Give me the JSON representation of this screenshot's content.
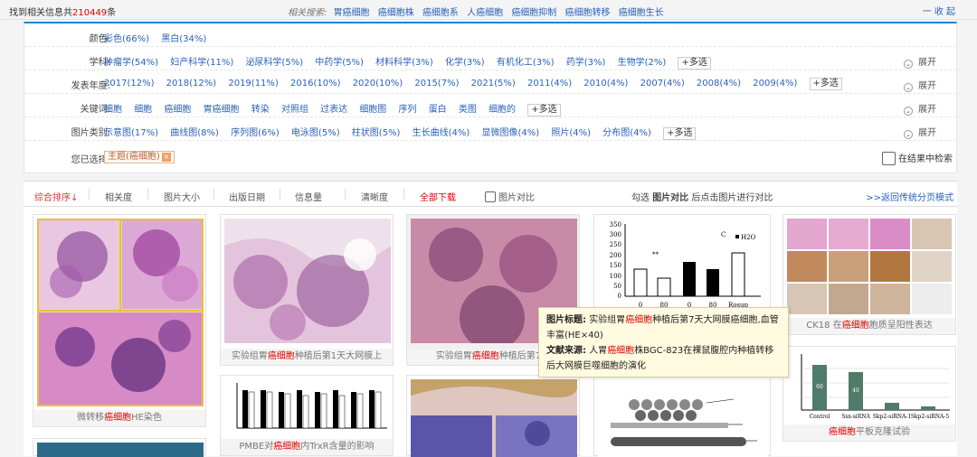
{
  "topbar": {
    "found_prefix": "找到相关信息共",
    "found_count": "210449",
    "found_suffix": "条",
    "related_label": "相关搜索:",
    "related_terms": [
      "胃癌细胞",
      "癌细胞株",
      "癌细胞系",
      "人癌细胞",
      "癌细胞抑制",
      "癌细胞转移",
      "癌细胞生长"
    ],
    "collapse_label": "一 收 起"
  },
  "filters": {
    "color": {
      "label": "颜色:",
      "options": [
        "彩色(66%)",
        "黑白(34%)"
      ]
    },
    "subject": {
      "label": "学科:",
      "options": [
        "肿瘤学(54%)",
        "妇产科学(11%)",
        "泌尿科学(5%)",
        "中药学(5%)",
        "材料科学(3%)",
        "化学(3%)",
        "有机化工(3%)",
        "药学(3%)",
        "生物学(2%)"
      ],
      "more": "+多选",
      "expand": "展开"
    },
    "year": {
      "label": "发表年度:",
      "options": [
        "2017(12%)",
        "2018(12%)",
        "2019(11%)",
        "2016(10%)",
        "2020(10%)",
        "2015(7%)",
        "2021(5%)",
        "2011(4%)",
        "2010(4%)",
        "2007(4%)",
        "2008(4%)",
        "2009(4%)"
      ],
      "more": "+多选",
      "expand": "展开"
    },
    "keyword": {
      "label": "关键词:",
      "options": [
        "细胞",
        "细胞",
        "癌细胞",
        "胃癌细胞",
        "转染",
        "对照组",
        "过表达",
        "细胞图",
        "序列",
        "蛋白",
        "类图",
        "细胞的"
      ],
      "more": "+多选",
      "expand": "展开"
    },
    "imgtype": {
      "label": "图片类别:",
      "options": [
        "示意图(17%)",
        "曲线图(8%)",
        "序列图(6%)",
        "电泳图(5%)",
        "柱状图(5%)",
        "生长曲线(4%)",
        "显微图像(4%)",
        "照片(4%)",
        "分布图(4%)"
      ],
      "more": "+多选",
      "expand": "展开"
    },
    "selected": {
      "label": "您已选择:",
      "tag": "主题(癌细胞)",
      "tag_close": "×",
      "search_in_results": "在结果中检索"
    }
  },
  "sortbar": {
    "items": [
      "综合排序↓",
      "相关度",
      "图片大小",
      "出版日期",
      "信息量",
      "清晰度"
    ],
    "download_all": "全部下载",
    "compare": "图片对比",
    "hint_pre": "勾选 ",
    "hint_bold": "图片对比",
    "hint_post": " 后点击图片进行对比",
    "back": ">>返回传统分页模式"
  },
  "cards": [
    {
      "pre": "微转移",
      "hl": "癌细胞",
      "post": "HE染色"
    },
    {
      "pre": "实验组胃",
      "hl": "癌细胞",
      "post": "种植后第1天大网膜上"
    },
    {
      "pre": "实验组胃",
      "hl": "癌细胞",
      "post": "种植后第7天"
    },
    {
      "pre": "CK18 在",
      "hl": "癌细胞",
      "post": "胞质呈阳性表达"
    },
    {
      "pre": "PMBE对",
      "hl": "癌细胞",
      "post": "内TrxR含量的影响"
    },
    {
      "pre": "",
      "hl": "癌细胞",
      "post": "平板克隆试验"
    }
  ],
  "tooltip": {
    "title_label": "图片标题:",
    "title_pre": "实验组胃",
    "title_hl": "癌细胞",
    "title_post": "种植后第7天大网膜癌细胞,血管丰富(HE×40)",
    "source_label": "文献来源:",
    "source_pre": "人胃",
    "source_hl": "癌细胞",
    "source_post": "株BGC-823在裸鼠腹腔内种植转移后大网膜巨噬细胞的演化"
  },
  "charts": {
    "bar_a": {
      "yticks": [
        "350",
        "300",
        "250",
        "200",
        "150",
        "100",
        "50",
        "0"
      ],
      "xticks": [
        "0",
        "80",
        "0",
        "80",
        "Rosup"
      ],
      "legend": "H2O",
      "mark": "C",
      "sig": "**"
    },
    "bar_b": {
      "xticks": [
        "Control",
        "Ssx-siRNA",
        "Skp2-siRNA-1",
        "Skp2-siRNA-5"
      ],
      "values": [
        "60",
        "40"
      ]
    }
  },
  "colors": {
    "accent": "#1e86d1",
    "link": "#2a62b8",
    "highlight": "#dd0000"
  }
}
